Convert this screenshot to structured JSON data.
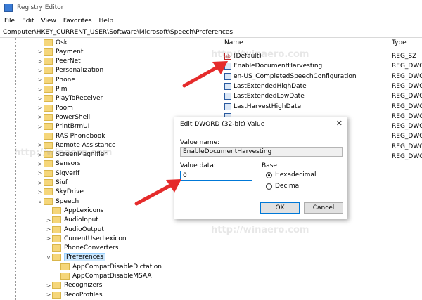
{
  "window": {
    "title": "Registry Editor"
  },
  "menu": [
    "File",
    "Edit",
    "View",
    "Favorites",
    "Help"
  ],
  "address": "Computer\\HKEY_CURRENT_USER\\Software\\Microsoft\\Speech\\Preferences",
  "tree": [
    {
      "label": "Osk",
      "expander": ""
    },
    {
      "label": "Payment",
      "expander": ">"
    },
    {
      "label": "PeerNet",
      "expander": ">"
    },
    {
      "label": "Personalization",
      "expander": ">"
    },
    {
      "label": "Phone",
      "expander": ">"
    },
    {
      "label": "Pim",
      "expander": ">"
    },
    {
      "label": "PlayToReceiver",
      "expander": ">"
    },
    {
      "label": "Poom",
      "expander": ">"
    },
    {
      "label": "PowerShell",
      "expander": ">"
    },
    {
      "label": "PrintBrmUI",
      "expander": ">"
    },
    {
      "label": "RAS Phonebook",
      "expander": ""
    },
    {
      "label": "Remote Assistance",
      "expander": ">"
    },
    {
      "label": "ScreenMagnifier",
      "expander": ">"
    },
    {
      "label": "Sensors",
      "expander": ">"
    },
    {
      "label": "Sigverif",
      "expander": ">"
    },
    {
      "label": "Siuf",
      "expander": ">"
    },
    {
      "label": "SkyDrive",
      "expander": ">"
    },
    {
      "label": "Speech",
      "expander": "v"
    },
    {
      "label": "AppLexicons",
      "expander": ""
    },
    {
      "label": "AudioInput",
      "expander": ">"
    },
    {
      "label": "AudioOutput",
      "expander": ">"
    },
    {
      "label": "CurrentUserLexicon",
      "expander": ">"
    },
    {
      "label": "PhoneConverters",
      "expander": ""
    },
    {
      "label": "Preferences",
      "expander": "v"
    },
    {
      "label": "AppCompatDisableDictation",
      "expander": ""
    },
    {
      "label": "AppCompatDisableMSAA",
      "expander": ""
    },
    {
      "label": "Recognizers",
      "expander": ">"
    },
    {
      "label": "RecoProfiles",
      "expander": ">"
    }
  ],
  "list": {
    "headers": {
      "name": "Name",
      "type": "Type"
    },
    "rows": [
      {
        "name": "(Default)",
        "type": "REG_SZ",
        "icon": "string-value-icon"
      },
      {
        "name": "EnableDocumentHarvesting",
        "type": "REG_DWORD",
        "icon": "dword-value-icon"
      },
      {
        "name": "en-US_CompletedSpeechConfiguration",
        "type": "REG_DWORD",
        "icon": "dword-value-icon"
      },
      {
        "name": "LastExtendedHighDate",
        "type": "REG_DWORD",
        "icon": "dword-value-icon"
      },
      {
        "name": "LastExtendedLowDate",
        "type": "REG_DWORD",
        "icon": "dword-value-icon"
      },
      {
        "name": "LastHarvestHighDate",
        "type": "REG_DWORD",
        "icon": "dword-value-icon"
      },
      {
        "name": "",
        "type": "REG_DWORD",
        "icon": "dword-value-icon"
      },
      {
        "name": "",
        "type": "REG_DWORD",
        "icon": "dword-value-icon"
      },
      {
        "name": "",
        "type": "REG_DWORD",
        "icon": "dword-value-icon"
      },
      {
        "name": "",
        "type": "REG_DWORD",
        "icon": "dword-value-icon"
      },
      {
        "name": "",
        "type": "REG_DWORD",
        "icon": "dword-value-icon"
      }
    ]
  },
  "dialog": {
    "title": "Edit DWORD (32-bit) Value",
    "value_name_label": "Value name:",
    "value_name": "EnableDocumentHarvesting",
    "value_data_label": "Value data:",
    "value_data": "0",
    "base_label": "Base",
    "hex_label": "Hexadecimal",
    "dec_label": "Decimal",
    "ok": "OK",
    "cancel": "Cancel",
    "close": "✕"
  },
  "watermark": "http://winaero.com",
  "colors": {
    "selection": "#cce8ff",
    "arrow": "#e52b2b",
    "folder": "#f5d67a",
    "accent": "#0078d7"
  }
}
